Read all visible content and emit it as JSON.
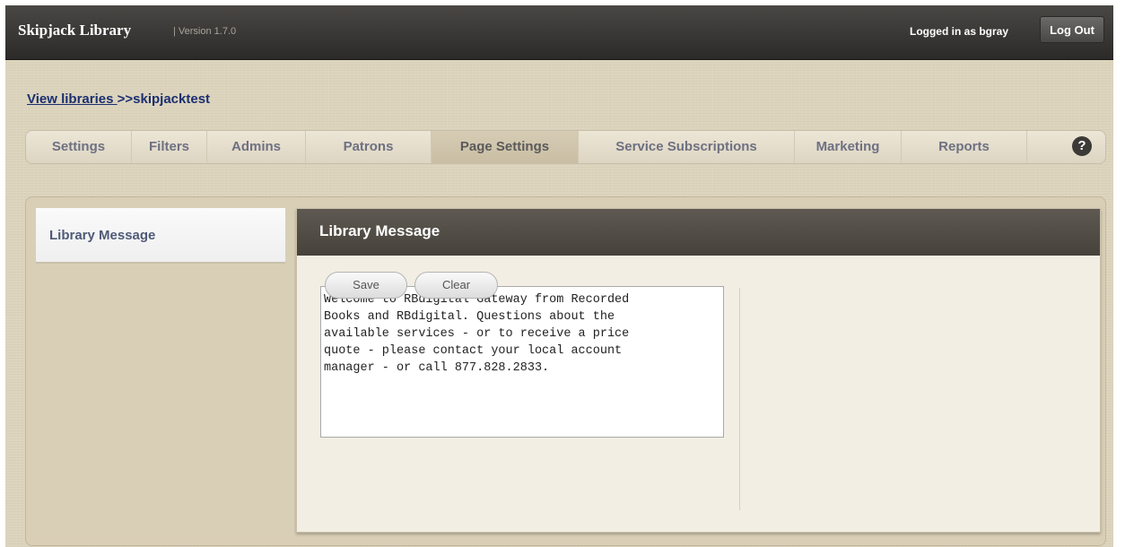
{
  "header": {
    "app_name": "Skipjack Library",
    "version": "| Version 1.7.0",
    "logged_in": "Logged in as bgray",
    "logout_label": "Log Out"
  },
  "breadcrumb": {
    "link_label": "View libraries ",
    "current": ">>skipjacktest"
  },
  "tabs": [
    {
      "label": "Settings",
      "active": false
    },
    {
      "label": "Filters",
      "active": false
    },
    {
      "label": "Admins",
      "active": false
    },
    {
      "label": "Patrons",
      "active": false
    },
    {
      "label": "Page Settings",
      "active": true
    },
    {
      "label": "Service Subscriptions",
      "active": false
    },
    {
      "label": "Marketing",
      "active": false
    },
    {
      "label": "Reports",
      "active": false
    }
  ],
  "help": {
    "icon": "help-icon",
    "glyph": "?"
  },
  "sidebar": {
    "items": [
      {
        "label": "Library Message",
        "selected": true
      }
    ]
  },
  "panel": {
    "title": "Library Message",
    "message": "Welcome to RBdigital Gateway from Recorded\nBooks and RBdigital. Questions about the\navailable services - or to receive a price\nquote - please contact your local account\nmanager - or call 877.828.2833.",
    "save_label": "Save",
    "clear_label": "Clear"
  },
  "colors": {
    "background": "#ddd4bd",
    "topbar": "#3a3835",
    "link": "#1a2f70",
    "tab_text": "#6e7082"
  }
}
